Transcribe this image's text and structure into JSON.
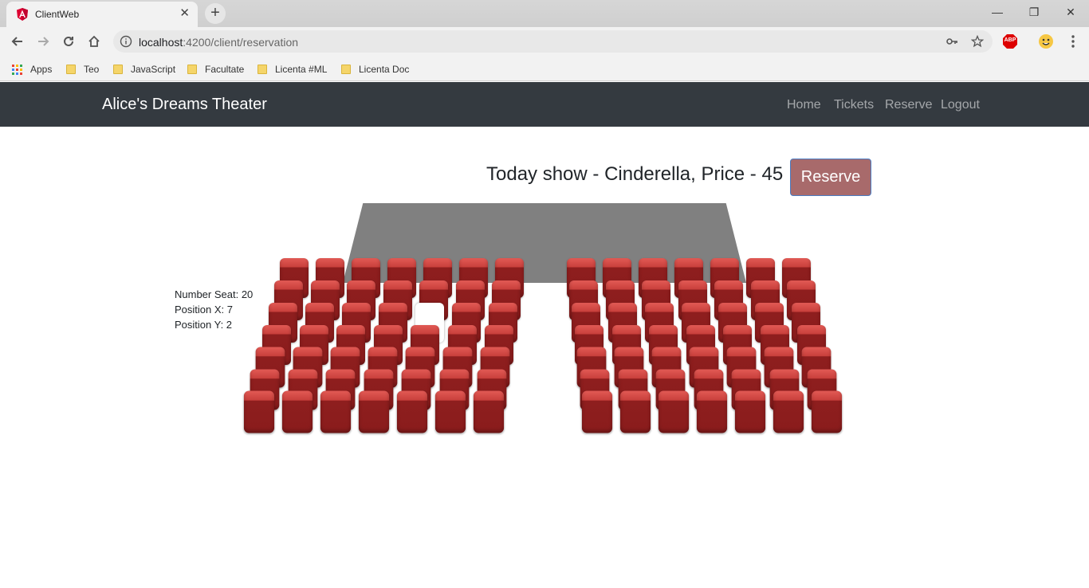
{
  "browser": {
    "tab_title": "ClientWeb",
    "tab_close": "✕",
    "new_tab": "+",
    "url_host": "localhost",
    "url_path": ":4200/client/reservation",
    "window_controls": [
      "—",
      "❐",
      "✕"
    ],
    "bookmarks": [
      {
        "label": "Apps",
        "icon": "apps-grid-icon"
      },
      {
        "label": "Teo",
        "icon": "folder-icon"
      },
      {
        "label": "JavaScript",
        "icon": "folder-icon"
      },
      {
        "label": "Facultate",
        "icon": "folder-icon"
      },
      {
        "label": "Licenta #ML",
        "icon": "folder-icon"
      },
      {
        "label": "Licenta Doc",
        "icon": "folder-icon"
      }
    ],
    "extension_abp": "ABP"
  },
  "navbar": {
    "brand": "Alice's Dreams Theater",
    "links": [
      "Home",
      "Tickets",
      "Reserve",
      "Logout"
    ],
    "background": "#343a40"
  },
  "show": {
    "title": "Today show - Cinderella, Price - 45",
    "reserve_label": "Reserve",
    "reserve_color": "#a86a6b"
  },
  "seat_info": {
    "number_seat": "Number Seat: 20",
    "position_x": "Position X: 7",
    "position_y": "Position Y: 2"
  },
  "seating": {
    "rows": 7,
    "seats_per_block": 7,
    "blocks": [
      "left",
      "right"
    ],
    "selected": {
      "block": "left",
      "row": 2,
      "col": 4
    },
    "seat_color": "#8a1c1c",
    "selected_color": "#ffffff"
  }
}
